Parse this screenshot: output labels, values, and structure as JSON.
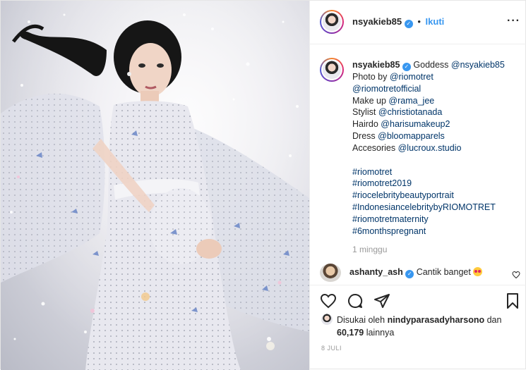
{
  "header": {
    "username": "nsyakieb85",
    "separator": "•",
    "follow_label": "Ikuti",
    "more_label": "···"
  },
  "caption": {
    "username": "nsyakieb85",
    "lines": [
      {
        "prefix": "Goddess ",
        "mention": "@nsyakieb85"
      },
      {
        "prefix": "Photo by ",
        "mention": "@riomotret"
      },
      {
        "prefix": "",
        "mention": "@riomotretofficial"
      },
      {
        "prefix": "Make up ",
        "mention": "@rama_jee"
      },
      {
        "prefix": "Stylist ",
        "mention": "@christiotanada"
      },
      {
        "prefix": "Hairdo ",
        "mention": "@harisumakeup2"
      },
      {
        "prefix": "Dress ",
        "mention": "@bloomapparels"
      },
      {
        "prefix": "Accesories ",
        "mention": "@lucroux.studio"
      }
    ],
    "hashtags": [
      "#riomotret",
      "#riomotret2019",
      "#riocelebritybeautyportrait",
      "#IndonesiancelebritybyRIOMOTRET",
      "#riomotretmaternity",
      "#6monthspregnant"
    ],
    "time_ago": "1 minggu"
  },
  "comment": {
    "username": "ashanty_ash",
    "text": "Cantik banget"
  },
  "likes": {
    "prefix": "Disukai oleh ",
    "liker": "nindyparasadyharsono",
    "connector": " dan",
    "count": "60,179",
    "suffix": " lainnya"
  },
  "date": "8 JULI",
  "icons": {
    "verified": "verified-badge-icon",
    "more": "more-options-icon",
    "like": "heart-icon",
    "comment": "comment-bubble-icon",
    "share": "paper-plane-icon",
    "save": "bookmark-icon"
  },
  "colors": {
    "link": "#003569",
    "follow": "#3897f0",
    "verified": "#3897f0",
    "muted": "#999999"
  }
}
